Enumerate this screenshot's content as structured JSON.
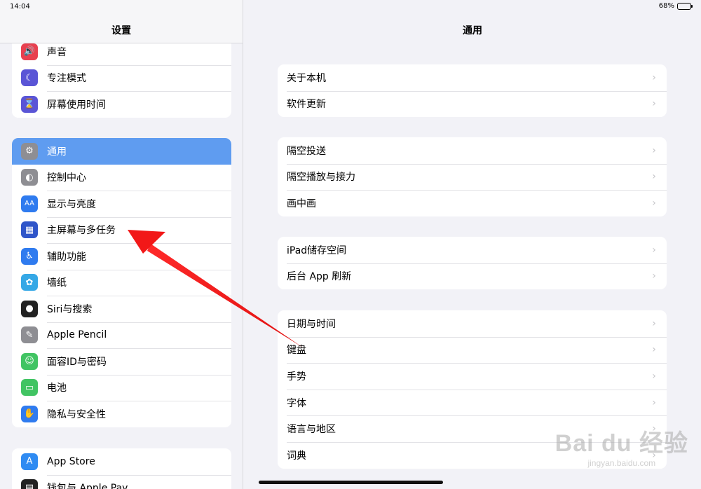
{
  "status": {
    "time": "14:04",
    "battery": "68%",
    "battery_level": 0.68
  },
  "sidebar": {
    "title": "设置",
    "groups": [
      {
        "items": [
          {
            "label": "声音",
            "icon": "speaker-icon",
            "color": "#e8404f"
          },
          {
            "label": "专注模式",
            "icon": "moon-icon",
            "color": "#5a55d6"
          },
          {
            "label": "屏幕使用时间",
            "icon": "hourglass-icon",
            "color": "#5a55d6"
          }
        ]
      },
      {
        "items": [
          {
            "label": "通用",
            "icon": "gear-icon",
            "color": "#8e8e93",
            "selected": true
          },
          {
            "label": "控制中心",
            "icon": "toggles-icon",
            "color": "#8e8e93"
          },
          {
            "label": "显示与亮度",
            "icon": "text-size-icon",
            "color": "#2f7bef"
          },
          {
            "label": "主屏幕与多任务",
            "icon": "home-grid-icon",
            "color": "#2f55c9"
          },
          {
            "label": "辅助功能",
            "icon": "accessibility-icon",
            "color": "#2f7bef"
          },
          {
            "label": "墙纸",
            "icon": "flower-icon",
            "color": "#35a8e6"
          },
          {
            "label": "Siri与搜索",
            "icon": "siri-icon",
            "color": "#222222"
          },
          {
            "label": "Apple Pencil",
            "icon": "pencil-icon",
            "color": "#8e8e93"
          },
          {
            "label": "面容ID与密码",
            "icon": "face-id-icon",
            "color": "#41c463"
          },
          {
            "label": "电池",
            "icon": "battery-icon",
            "color": "#41c463"
          },
          {
            "label": "隐私与安全性",
            "icon": "hand-icon",
            "color": "#2f7bef"
          }
        ]
      },
      {
        "items": [
          {
            "label": "App Store",
            "icon": "app-store-icon",
            "color": "#2f8bf2"
          },
          {
            "label": "钱包与 Apple Pay",
            "icon": "wallet-icon",
            "color": "#222222"
          }
        ]
      }
    ]
  },
  "main": {
    "title": "通用",
    "groups": [
      {
        "items": [
          "关于本机",
          "软件更新"
        ]
      },
      {
        "items": [
          "隔空投送",
          "隔空播放与接力",
          "画中画"
        ]
      },
      {
        "items": [
          "iPad储存空间",
          "后台 App 刷新"
        ]
      },
      {
        "items": [
          "日期与时间",
          "键盘",
          "手势",
          "字体",
          "语言与地区",
          "词典"
        ]
      }
    ],
    "chevron": "›"
  },
  "watermark": {
    "main": "Bai du 经验",
    "sub": "jingyan.baidu.com"
  }
}
